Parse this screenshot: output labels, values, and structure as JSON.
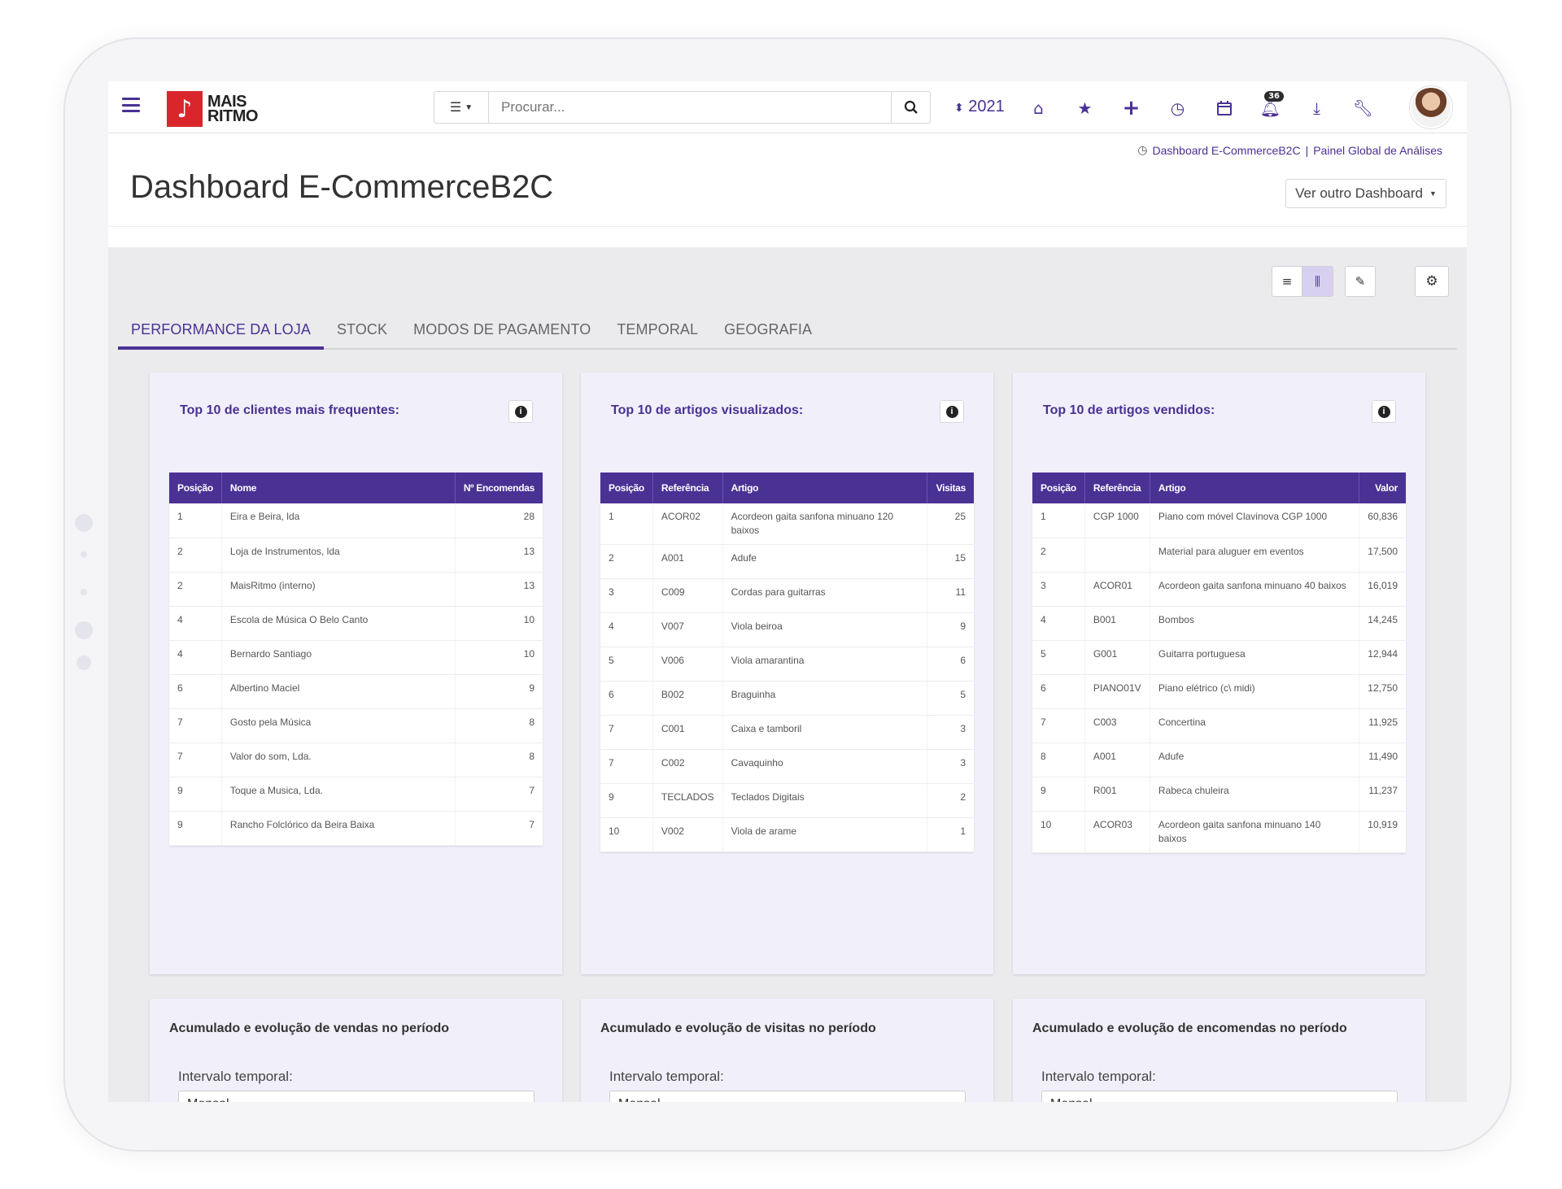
{
  "app": {
    "logo_line1": "MAIS",
    "logo_line2": "RITMO",
    "logo_glyph": "♪"
  },
  "search": {
    "placeholder": "Procurar..."
  },
  "year": "2021",
  "notifications_count": "36",
  "breadcrumb": {
    "item1": "Dashboard E-CommerceB2C",
    "separator": "|",
    "item2": "Painel Global de Análises"
  },
  "page_title": "Dashboard E-CommerceB2C",
  "other_dashboard_label": "Ver outro Dashboard",
  "tabs": [
    {
      "label": "Performance da Loja"
    },
    {
      "label": "Stock"
    },
    {
      "label": "Modos de Pagamento"
    },
    {
      "label": "Temporal"
    },
    {
      "label": "Geografia"
    }
  ],
  "colors": {
    "accent": "#4a3194",
    "brand_red": "#d9262c"
  },
  "panel1": {
    "title": "Top 10 de clientes mais frequentes:",
    "headers": [
      "Posição",
      "Nome",
      "Nº Encomendas"
    ],
    "rows": [
      [
        "1",
        "Eira e Beira, lda",
        "28"
      ],
      [
        "2",
        "Loja de Instrumentos, lda",
        "13"
      ],
      [
        "2",
        "MaisRitmo (interno)",
        "13"
      ],
      [
        "4",
        "Escola de Música O Belo Canto",
        "10"
      ],
      [
        "4",
        "Bernardo Santiago",
        "10"
      ],
      [
        "6",
        "Albertino Maciel",
        "9"
      ],
      [
        "7",
        "Gosto pela Música",
        "8"
      ],
      [
        "7",
        "Valor do som, Lda.",
        "8"
      ],
      [
        "9",
        "Toque a Musica, Lda.",
        "7"
      ],
      [
        "9",
        "Rancho Folclórico da Beira Baixa",
        "7"
      ]
    ]
  },
  "panel2": {
    "title": "Top 10 de artigos visualizados:",
    "headers": [
      "Posição",
      "Referência",
      "Artigo",
      "Visitas"
    ],
    "rows": [
      [
        "1",
        "ACOR02",
        "Acordeon gaita sanfona minuano 120 baixos",
        "25"
      ],
      [
        "2",
        "A001",
        "Adufe",
        "15"
      ],
      [
        "3",
        "C009",
        "Cordas para guitarras",
        "11"
      ],
      [
        "4",
        "V007",
        "Viola beiroa",
        "9"
      ],
      [
        "5",
        "V006",
        "Viola amarantina",
        "6"
      ],
      [
        "6",
        "B002",
        "Braguinha",
        "5"
      ],
      [
        "7",
        "C001",
        "Caixa e tamboril",
        "3"
      ],
      [
        "7",
        "C002",
        "Cavaquinho",
        "3"
      ],
      [
        "9",
        "TECLADOS",
        "Teclados Digitais",
        "2"
      ],
      [
        "10",
        "V002",
        "Viola de arame",
        "1"
      ]
    ]
  },
  "panel3": {
    "title": "Top 10 de artigos vendidos:",
    "headers": [
      "Posição",
      "Referência",
      "Artigo",
      "Valor"
    ],
    "rows": [
      [
        "1",
        "CGP 1000",
        "Piano com móvel Clavinova CGP 1000",
        "60,836"
      ],
      [
        "2",
        "",
        "Material para aluguer em eventos",
        "17,500"
      ],
      [
        "3",
        "ACOR01",
        "Acordeon gaita sanfona minuano 40 baixos",
        "16,019"
      ],
      [
        "4",
        "B001",
        "Bombos",
        "14,245"
      ],
      [
        "5",
        "G001",
        "Guitarra portuguesa",
        "12,944"
      ],
      [
        "6",
        "PIANO01V",
        "Piano elétrico (c\\ midi)",
        "12,750"
      ],
      [
        "7",
        "C003",
        "Concertina",
        "11,925"
      ],
      [
        "8",
        "A001",
        "Adufe",
        "11,490"
      ],
      [
        "9",
        "R001",
        "Rabeca chuleira",
        "11,237"
      ],
      [
        "10",
        "ACOR03",
        "Acordeon gaita sanfona minuano 140 baixos",
        "10,919"
      ]
    ]
  },
  "bottom_cards": [
    {
      "title": "Acumulado e evolução de vendas no período",
      "label": "Intervalo temporal:",
      "value": "Mensal"
    },
    {
      "title": "Acumulado e evolução de visitas no período",
      "label": "Intervalo temporal:",
      "value": "Mensal"
    },
    {
      "title": "Acumulado e evolução de encomendas no período",
      "label": "Intervalo temporal:",
      "value": "Mensal"
    }
  ]
}
